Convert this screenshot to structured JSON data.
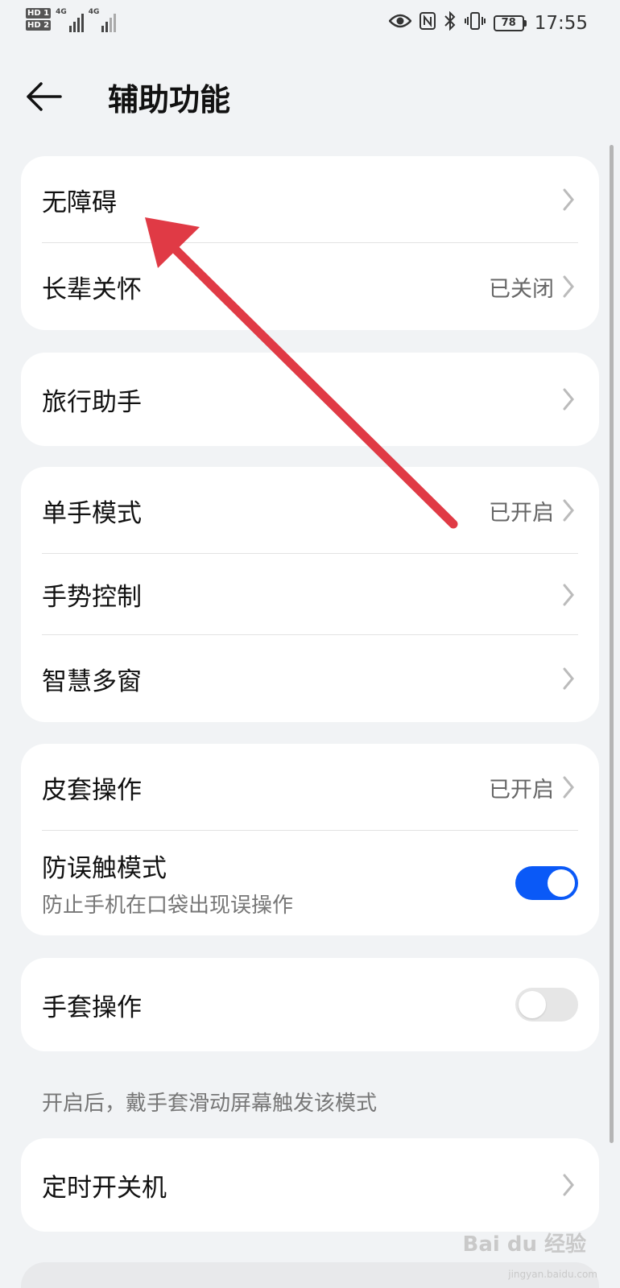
{
  "status_bar": {
    "sim1": "HD 1",
    "sim2": "HD 2",
    "network1": "4G",
    "network2": "4G",
    "battery": "78",
    "time": "17:55"
  },
  "header": {
    "title": "辅助功能"
  },
  "groups": [
    {
      "items": [
        {
          "label": "无障碍",
          "value": ""
        },
        {
          "label": "长辈关怀",
          "value": "已关闭"
        }
      ]
    },
    {
      "items": [
        {
          "label": "旅行助手",
          "value": ""
        }
      ]
    },
    {
      "items": [
        {
          "label": "单手模式",
          "value": "已开启"
        },
        {
          "label": "手势控制",
          "value": ""
        },
        {
          "label": "智慧多窗",
          "value": ""
        }
      ]
    },
    {
      "items": [
        {
          "label": "皮套操作",
          "value": "已开启"
        },
        {
          "label": "防误触模式",
          "subtitle": "防止手机在口袋出现误操作",
          "toggle": true
        }
      ]
    },
    {
      "items": [
        {
          "label": "手套操作",
          "toggle": false
        }
      ],
      "note": "开启后，戴手套滑动屏幕触发该模式"
    },
    {
      "items": [
        {
          "label": "定时开关机",
          "value": ""
        }
      ]
    }
  ],
  "watermark": {
    "text": "Bai du 经验",
    "sub": "jingyan.baidu.com"
  },
  "colors": {
    "accent": "#0a59f7",
    "annotation_arrow": "#e03a45",
    "background": "#f1f3f5"
  }
}
